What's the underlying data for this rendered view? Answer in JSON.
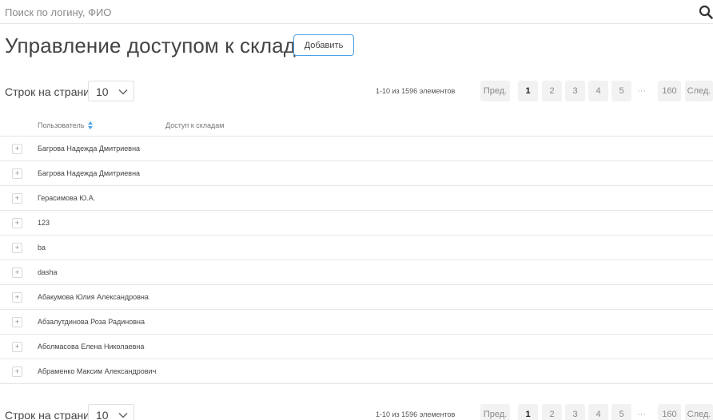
{
  "search": {
    "placeholder": "Поиск по логину, ФИО",
    "icon": "search-icon"
  },
  "page": {
    "title": "Управление доступом к складам",
    "add_label": "Добавить"
  },
  "pagination": {
    "rows_label": "Строк на странице",
    "rows_value": "10",
    "range_text": "1-10 из 1596 элементов",
    "prev_label": "Пред.",
    "next_label": "След.",
    "pages": [
      "1",
      "2",
      "3",
      "4",
      "5"
    ],
    "ellipsis": "···",
    "last_page": "160",
    "current_page": "1"
  },
  "table": {
    "columns": [
      "Пользователь",
      "Доступ к складам"
    ],
    "expand_symbol": "+",
    "rows": [
      "Багрова Надежда Дмитриевна",
      "Багрова Надежда Дмитриевна",
      "Герасимова Ю.А.",
      "123",
      "ba",
      "dasha",
      "Абакумова Юлия Александровна",
      "Абзалутдинова Роза Радиновна",
      "Аболмасова Елена Николаевна",
      "Абраменко Максим Александрович"
    ]
  },
  "colors": {
    "accent": "#4aa3e8",
    "border": "#e6e6e6"
  }
}
